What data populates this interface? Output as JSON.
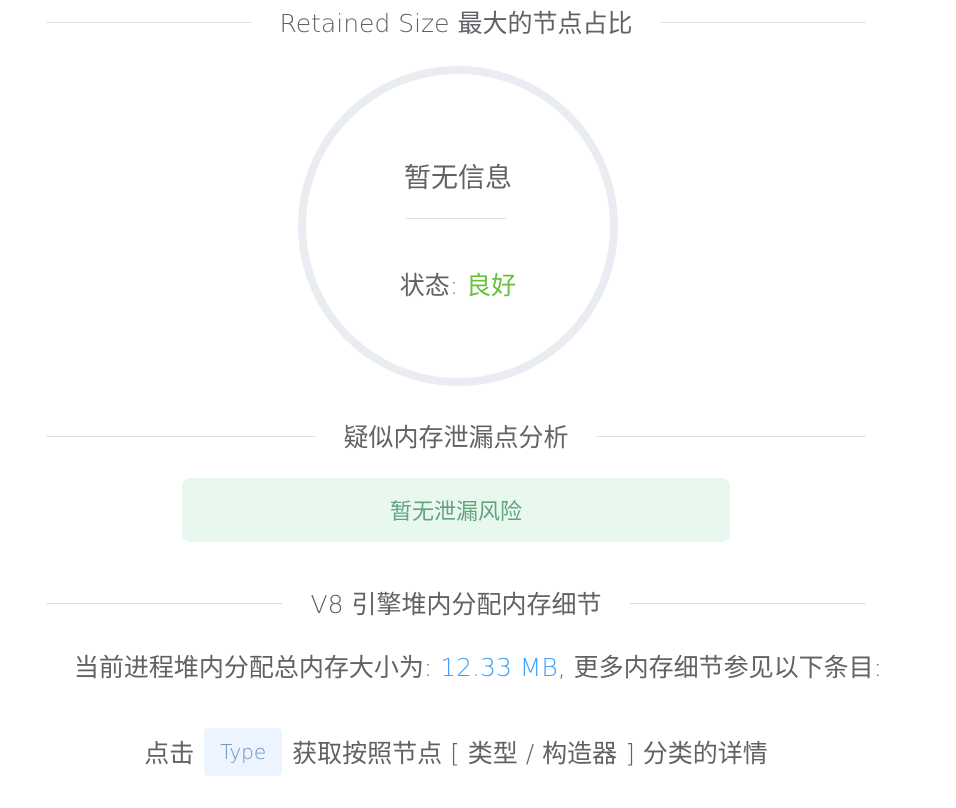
{
  "sections": {
    "retained": {
      "title": "Retained Size 最大的节点占比"
    },
    "leak": {
      "title": "疑似内存泄漏点分析"
    },
    "v8": {
      "title": "V8 引擎堆内分配内存细节"
    }
  },
  "circle": {
    "info": "暂无信息",
    "status_label": "状态: ",
    "status_value": "良好",
    "status_color": "#67c23a"
  },
  "leak_alert": {
    "text": "暂无泄漏风险"
  },
  "summary": {
    "prefix": "当前进程堆内分配总内存大小为: ",
    "size": "12.33 MB",
    "suffix": ", 更多内存细节参见以下条目:"
  },
  "hint": {
    "before": "点击",
    "tag": "Type",
    "after": "获取按照节点 [ 类型 / 构造器 ] 分类的详情"
  },
  "colors": {
    "accent_blue": "#409eff",
    "success_green": "#67c23a",
    "alert_bg": "#e8f8ef"
  }
}
